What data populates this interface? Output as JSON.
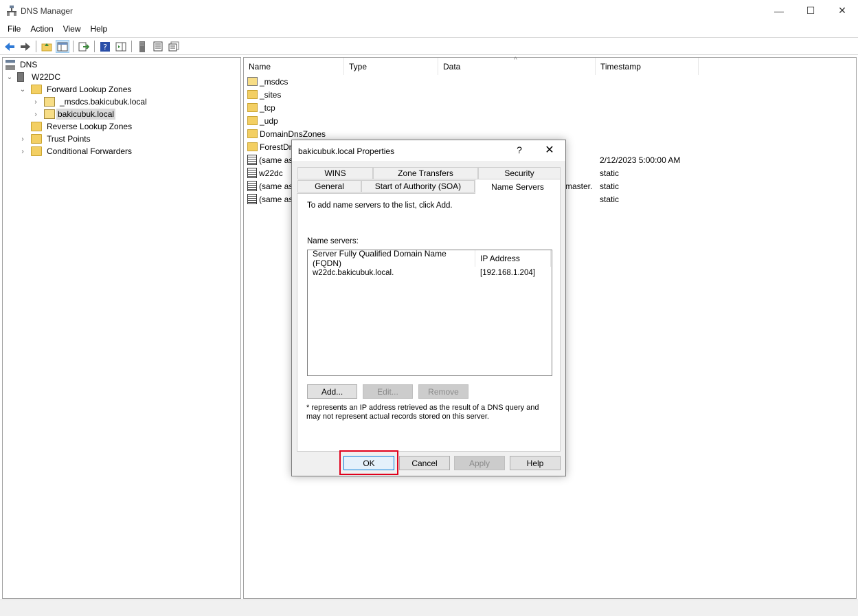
{
  "window": {
    "title": "DNS Manager",
    "minimize": "—",
    "maximize": "☐",
    "close": "✕"
  },
  "menu": [
    "File",
    "Action",
    "View",
    "Help"
  ],
  "tree": {
    "root": "DNS",
    "server": "W22DC",
    "forward": "Forward Lookup Zones",
    "msdcs": "_msdcs.bakicubuk.local",
    "zone": "bakicubuk.local",
    "reverse": "Reverse Lookup Zones",
    "trust": "Trust Points",
    "conditional": "Conditional Forwarders"
  },
  "list": {
    "columns": [
      "Name",
      "Type",
      "Data",
      "Timestamp"
    ],
    "rows": [
      {
        "name": "_msdcs",
        "icon": "zone-icon",
        "timestamp": ""
      },
      {
        "name": "_sites",
        "icon": "folder-icon",
        "timestamp": ""
      },
      {
        "name": "_tcp",
        "icon": "folder-icon",
        "timestamp": ""
      },
      {
        "name": "_udp",
        "icon": "folder-icon",
        "timestamp": ""
      },
      {
        "name": "DomainDnsZones",
        "icon": "folder-icon",
        "timestamp": ""
      },
      {
        "name": "ForestDn",
        "icon": "folder-icon",
        "timestamp": ""
      },
      {
        "name": "(same as",
        "icon": "record-icon",
        "timestamp": "2/12/2023 5:00:00 AM"
      },
      {
        "name": "w22dc",
        "icon": "record-icon",
        "timestamp": "static"
      },
      {
        "name": "(same as",
        "icon": "record-icon",
        "data_tail": "master.",
        "timestamp": "static"
      },
      {
        "name": "(same as",
        "icon": "record-icon",
        "timestamp": "static"
      }
    ]
  },
  "dialog": {
    "title": "bakicubuk.local Properties",
    "help": "?",
    "close": "✕",
    "tabs_back": [
      "WINS",
      "Zone Transfers",
      "Security"
    ],
    "tabs_front": [
      "General",
      "Start of Authority (SOA)",
      "Name Servers"
    ],
    "instructions": "To add name servers to the list, click Add.",
    "ns_label": "Name servers:",
    "lv_columns": [
      "Server Fully Qualified Domain Name (FQDN)",
      "IP Address"
    ],
    "lv_rows": [
      {
        "fqdn": "w22dc.bakicubuk.local.",
        "ip": "[192.168.1.204]"
      }
    ],
    "add": "Add...",
    "edit": "Edit...",
    "remove": "Remove",
    "note": "* represents an IP address retrieved as the result of a DNS query and may not represent actual records stored on this server.",
    "ok": "OK",
    "cancel": "Cancel",
    "apply": "Apply",
    "help_btn": "Help"
  },
  "colors": {
    "highlight": "#e0001b",
    "accent": "#0078d7"
  }
}
